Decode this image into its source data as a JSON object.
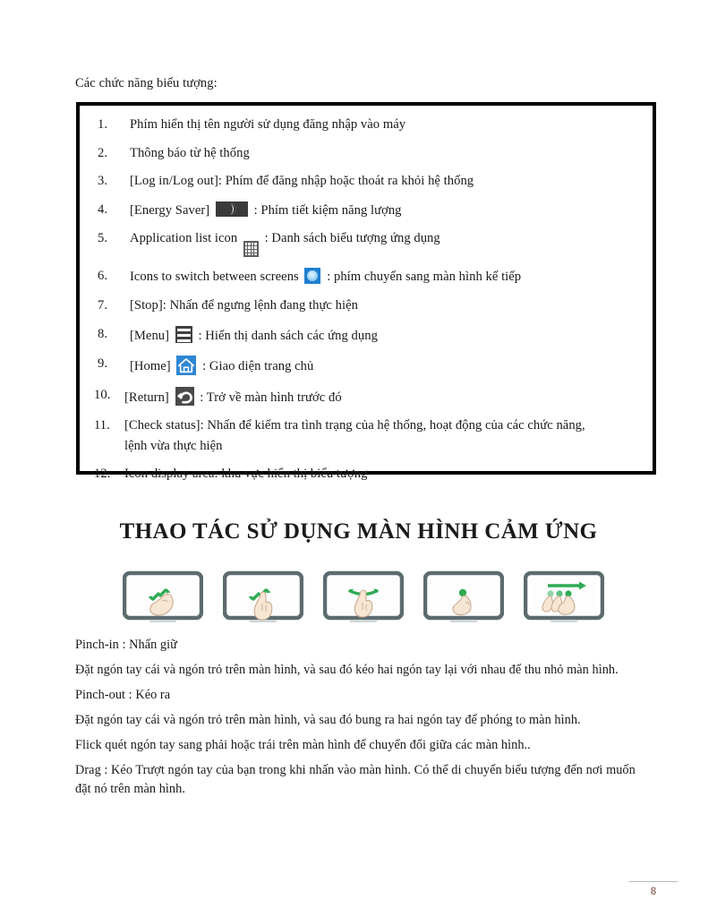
{
  "document": {
    "intro_line": "Các chức năng biểu tượng:",
    "icon_functions": [
      {
        "num": "1.",
        "text": "Phím hiển thị tên người sử dụng đăng nhập vào máy",
        "icon": null
      },
      {
        "num": "2.",
        "text": "Thông báo từ hệ thống",
        "icon": null
      },
      {
        "num": "3.",
        "text": "[Log in/Log out]: Phím để đăng nhập hoặc thoát ra khỏi hệ thống",
        "icon": null
      },
      {
        "num": "4.",
        "before": "[Energy Saver]",
        "icon": "moon-icon",
        "after": ": Phím tiết kiệm năng lượng"
      },
      {
        "num": "5.",
        "before": "Application list icon",
        "icon": "app-grid-icon",
        "after": ": Danh sách biểu tượng ứng dụng"
      },
      {
        "num": "6.",
        "before": "Icons to switch between screens",
        "icon": "screen-switch-icon",
        "after": ": phím chuyển sang màn hình kế tiếp"
      },
      {
        "num": "7.",
        "text": "[Stop]: Nhấn để ngưng lệnh đang thực hiện",
        "icon": null
      },
      {
        "num": "8.",
        "before": "[Menu]",
        "icon": "hamburger-menu-icon",
        "after": ": Hiển thị danh sách các ứng dụng"
      },
      {
        "num": "9.",
        "before": "[Home]",
        "icon": "home-icon",
        "after": ": Giao diện trang chủ"
      },
      {
        "num": "10.",
        "before": "[Return]",
        "icon": "return-arrow-icon",
        "after": ": Trở về màn hình trước đó"
      },
      {
        "num": "11.",
        "text": "[Check status]: Nhấn để kiểm tra tình trạng của hệ thống, hoạt động của các chức năng,",
        "text_line2": "lệnh vừa thực hiện",
        "icon": null
      },
      {
        "num": "12.",
        "text": "Icon display area: khu vực hiển thị biểu tượng",
        "icon": null
      }
    ],
    "section_heading": "THAO TÁC SỬ DỤNG MÀN HÌNH CẢM ỨNG",
    "gestures": [
      {
        "name": "pinch-in-figure",
        "label": "pinch-in"
      },
      {
        "name": "pinch-out-figure",
        "label": "pinch-out"
      },
      {
        "name": "flick-figure",
        "label": "flick"
      },
      {
        "name": "tap-figure",
        "label": "tap"
      },
      {
        "name": "drag-figure",
        "label": "drag"
      }
    ],
    "paragraphs": [
      "Pinch-in : Nhấn giữ",
      "Đặt ngón tay cái và ngón trỏ trên màn hình, và sau đó kéo hai ngón tay lại với nhau để thu nhỏ màn hình.",
      "Pinch-out : Kéo ra",
      "Đặt ngón tay cái và ngón trỏ trên màn hình, và sau đó bung ra hai ngón tay để phóng to màn hình.",
      "Flick  quét ngón tay sang phải hoặc trái trên màn hình để chuyển đổi giữa các màn hình..",
      "Drag : Kéo Trượt ngón tay của bạn trong khi nhấn vào màn hình. Có thể di chuyển biểu tượng đến nơi muốn đặt nó trên màn hình."
    ],
    "footer": {
      "page_number": "8"
    }
  },
  "colors": {
    "icon_blue": "#2f86d4",
    "icon_dark": "#3f3f3f",
    "gesture_green": "#2faa55",
    "screen_frame": "#5c6b70",
    "page_number": "#9a7b74"
  }
}
